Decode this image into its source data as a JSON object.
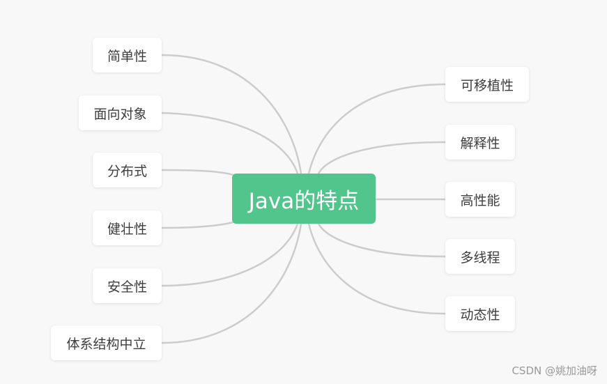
{
  "mindmap": {
    "root": "Java的特点",
    "left": [
      "简单性",
      "面向对象",
      "分布式",
      "健壮性",
      "安全性",
      "体系结构中立"
    ],
    "right": [
      "可移植性",
      "解释性",
      "高性能",
      "多线程",
      "动态性"
    ]
  },
  "colors": {
    "background": "#f8f8f8",
    "root": "#52c58c",
    "connector": "#cccccc",
    "node": "#ffffff"
  },
  "watermark": "CSDN @姚加油呀"
}
